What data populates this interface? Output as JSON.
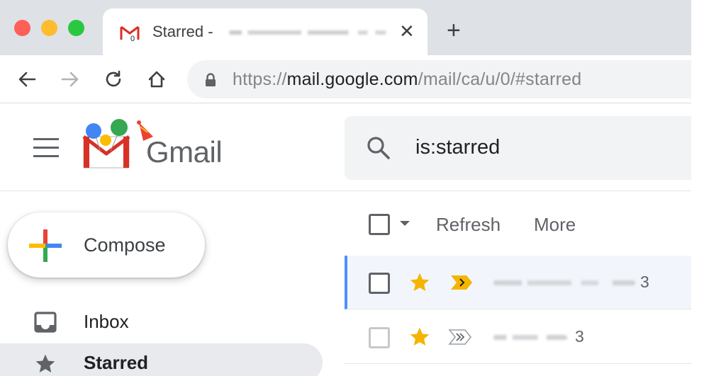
{
  "browser": {
    "tab": {
      "title": "Starred - ",
      "favicon": "gmail-m-icon"
    },
    "new_tab_label": "+",
    "close_label": "✕",
    "address": {
      "scheme": "https://",
      "host": "mail.google.com",
      "path": "/mail/ca/u/0/#starred"
    },
    "icons": [
      "back-arrow-icon",
      "forward-arrow-icon",
      "reload-icon",
      "home-icon",
      "lock-icon"
    ]
  },
  "gmail": {
    "logo_text": "Gmail",
    "search": {
      "value": "is:starred"
    },
    "compose_label": "Compose",
    "nav": [
      {
        "label": "Inbox",
        "icon": "inbox-icon",
        "active": false
      },
      {
        "label": "Starred",
        "icon": "star-icon",
        "active": true
      }
    ],
    "list_toolbar": {
      "refresh_label": "Refresh",
      "more_label": "More"
    },
    "messages": [
      {
        "count": "3",
        "starred": true,
        "importance": "important-marker-icon",
        "selected": true
      },
      {
        "count": "3",
        "starred": true,
        "importance": "important-marker-outline-icon",
        "selected": false
      }
    ],
    "colors": {
      "star": "#f4b400",
      "importance": "#f4b400",
      "selection_bar": "#4d90fe",
      "active_nav_bg": "#e8eaed"
    }
  }
}
